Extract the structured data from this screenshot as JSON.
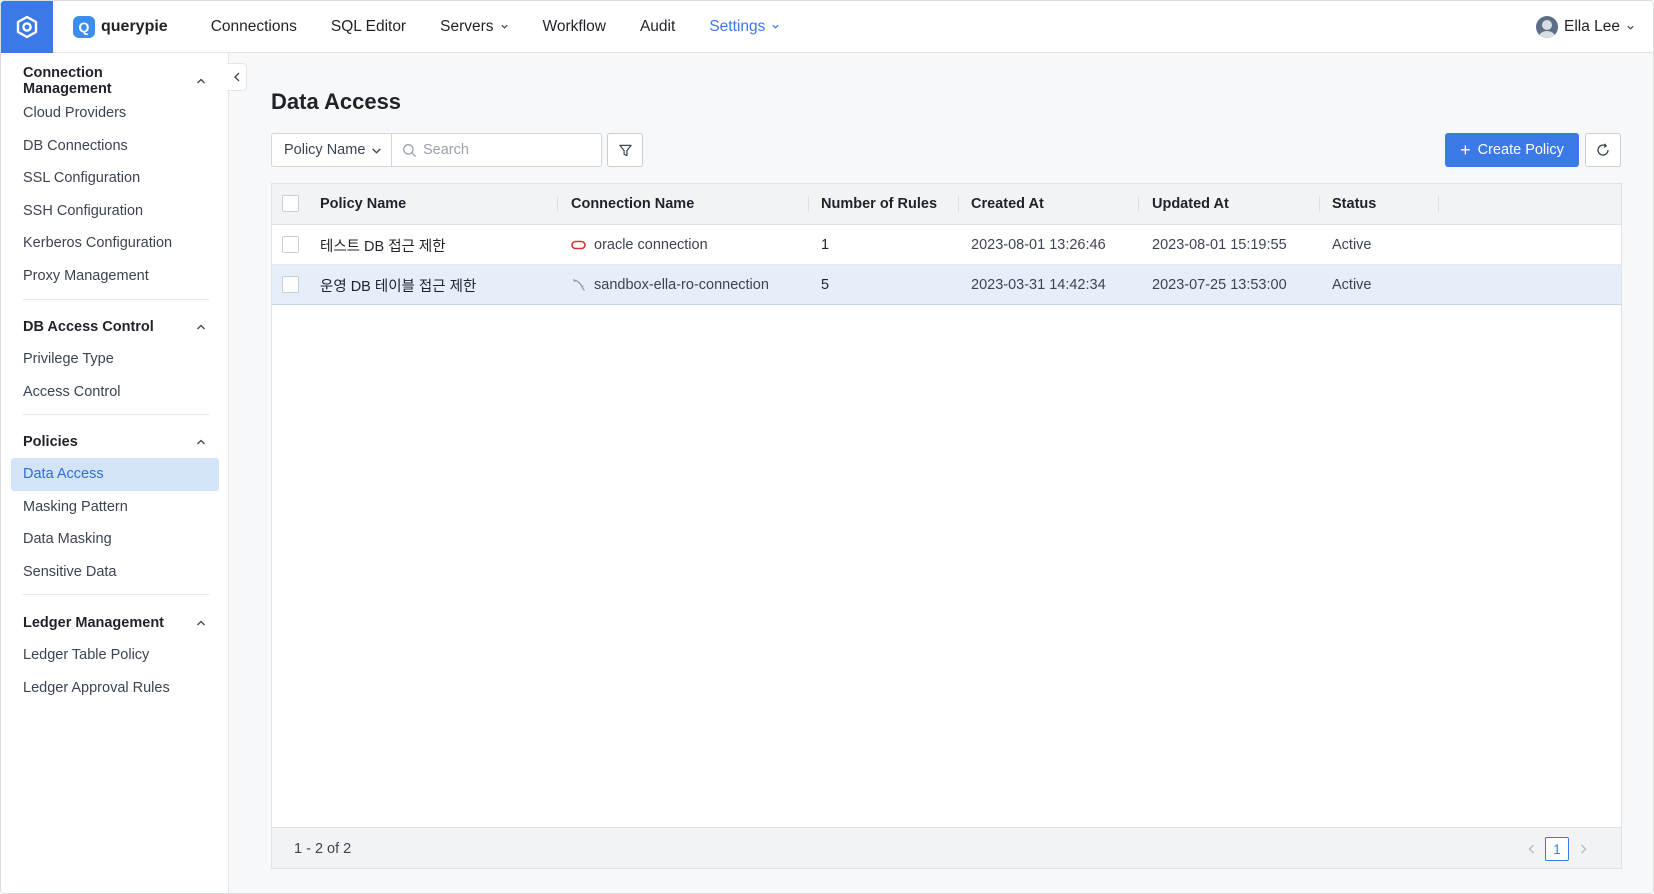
{
  "brand": {
    "mark": "Q",
    "name": "querypie"
  },
  "nav": {
    "items": [
      {
        "label": "Connections"
      },
      {
        "label": "SQL Editor"
      },
      {
        "label": "Servers"
      },
      {
        "label": "Workflow"
      },
      {
        "label": "Audit"
      },
      {
        "label": "Settings"
      }
    ],
    "active": "Settings",
    "user_name": "Ella Lee"
  },
  "sidebar": {
    "sections": [
      {
        "title": "Connection Management",
        "items": [
          "Cloud Providers",
          "DB Connections",
          "SSL Configuration",
          "SSH Configuration",
          "Kerberos Configuration",
          "Proxy Management"
        ]
      },
      {
        "title": "DB Access Control",
        "items": [
          "Privilege Type",
          "Access Control"
        ]
      },
      {
        "title": "Policies",
        "items": [
          "Data Access",
          "Masking Pattern",
          "Data Masking",
          "Sensitive Data"
        ]
      },
      {
        "title": "Ledger Management",
        "items": [
          "Ledger Table Policy",
          "Ledger Approval Rules"
        ]
      }
    ],
    "active_item": "Data Access"
  },
  "main": {
    "title": "Data Access",
    "search_field_select": "Policy Name",
    "search_placeholder": "Search",
    "create_button": "Create Policy",
    "table": {
      "columns": [
        "Policy Name",
        "Connection Name",
        "Number of Rules",
        "Created At",
        "Updated At",
        "Status"
      ],
      "rows": [
        {
          "policy_name": "테스트 DB 접근 제한",
          "connection_name": "oracle connection",
          "connection_icon": "oracle-icon",
          "rules": "1",
          "created_at": "2023-08-01 13:26:46",
          "updated_at": "2023-08-01 15:19:55",
          "status": "Active",
          "selected": false
        },
        {
          "policy_name": "운영 DB 테이블 접근 제한",
          "connection_name": "sandbox-ella-ro-connection",
          "connection_icon": "mysql-icon",
          "rules": "5",
          "created_at": "2023-03-31 14:42:34",
          "updated_at": "2023-07-25 13:53:00",
          "status": "Active",
          "selected": true
        }
      ]
    },
    "pagination": {
      "range_text": "1 - 2 of 2",
      "current_page": "1"
    }
  },
  "colors": {
    "accent": "#3b79e6",
    "selected_row": "#e5eef9",
    "active_sidebar": "#d3e3f8",
    "oracle_red": "#e0312a"
  }
}
